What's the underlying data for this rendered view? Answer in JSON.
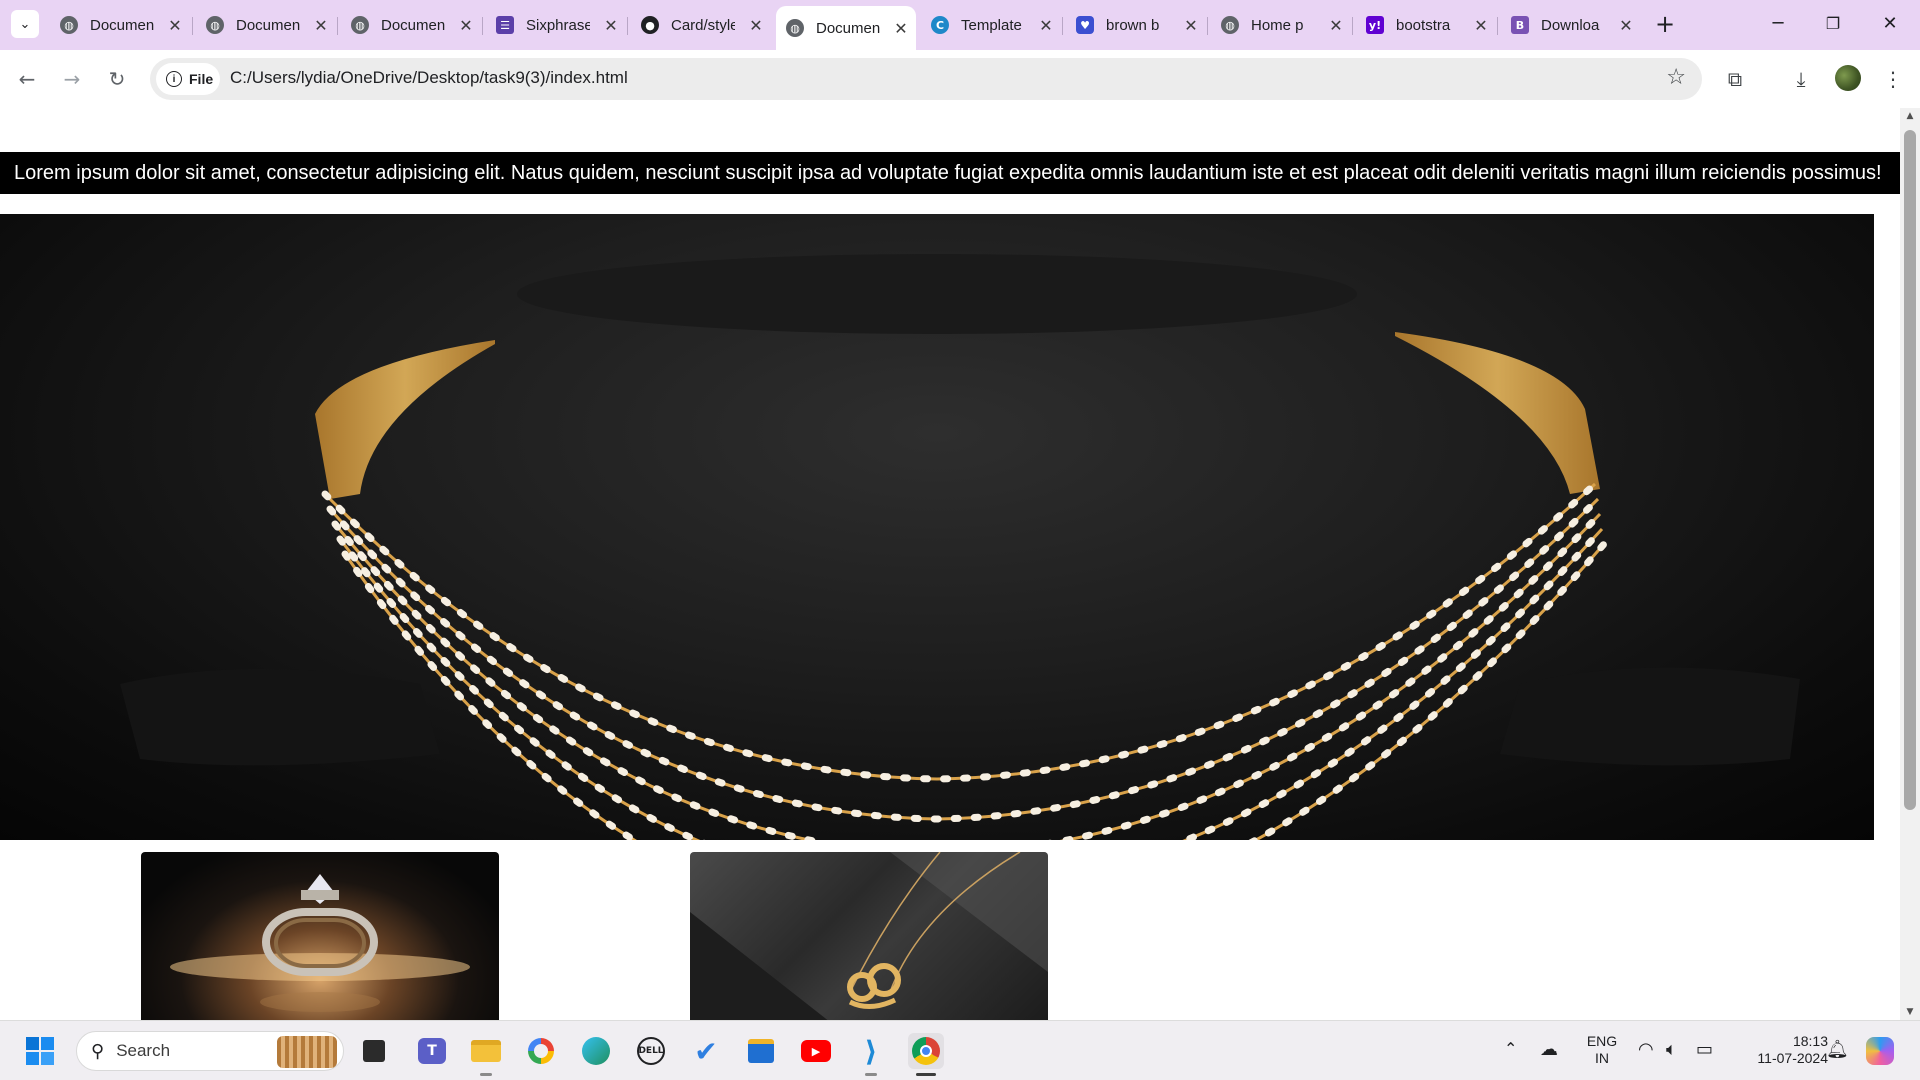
{
  "browser": {
    "tabs": [
      {
        "title": "Document",
        "icon": "globe-icon",
        "active": false
      },
      {
        "title": "Document",
        "icon": "globe-icon",
        "active": false
      },
      {
        "title": "Document",
        "icon": "globe-icon",
        "active": false
      },
      {
        "title": "Sixphrase",
        "icon": "sixphrase-icon",
        "active": false
      },
      {
        "title": "Card/style",
        "icon": "github-icon",
        "active": false
      },
      {
        "title": "Document",
        "icon": "globe-icon",
        "active": true
      },
      {
        "title": "Template",
        "icon": "canva-icon",
        "active": false
      },
      {
        "title": "brown b",
        "icon": "heart-shield-icon",
        "active": false
      },
      {
        "title": "Home p",
        "icon": "globe-icon",
        "active": false
      },
      {
        "title": "bootstra",
        "icon": "yahoo-icon",
        "active": false
      },
      {
        "title": "Downloa",
        "icon": "bootstrap-icon",
        "active": false
      }
    ],
    "address": {
      "scheme_label": "File",
      "url": "C:/Users/lydia/OneDrive/Desktop/task9(3)/index.html"
    }
  },
  "page": {
    "marquee_text": "Lorem ipsum dolor sit amet, consectetur adipisicing elit. Natus quidem, nesciunt suscipit ipsa ad voluptate fugiat expedita omnis laudantium iste et est placeat odit deleniti veritatis magni illum reiciendis possimus!",
    "hero_image": "gold-diamond-necklace-image",
    "thumbnails": [
      "diamond-ring-image",
      "gold-pendant-necklace-image"
    ]
  },
  "taskbar": {
    "search_placeholder": "Search",
    "language_line1": "ENG",
    "language_line2": "IN",
    "time": "18:13",
    "date": "11-07-2024"
  },
  "colors": {
    "tab_strip": "#e9d4f4",
    "marquee_bg": "#000000",
    "marquee_text": "#ffffff",
    "gold": "#d9a24a"
  }
}
